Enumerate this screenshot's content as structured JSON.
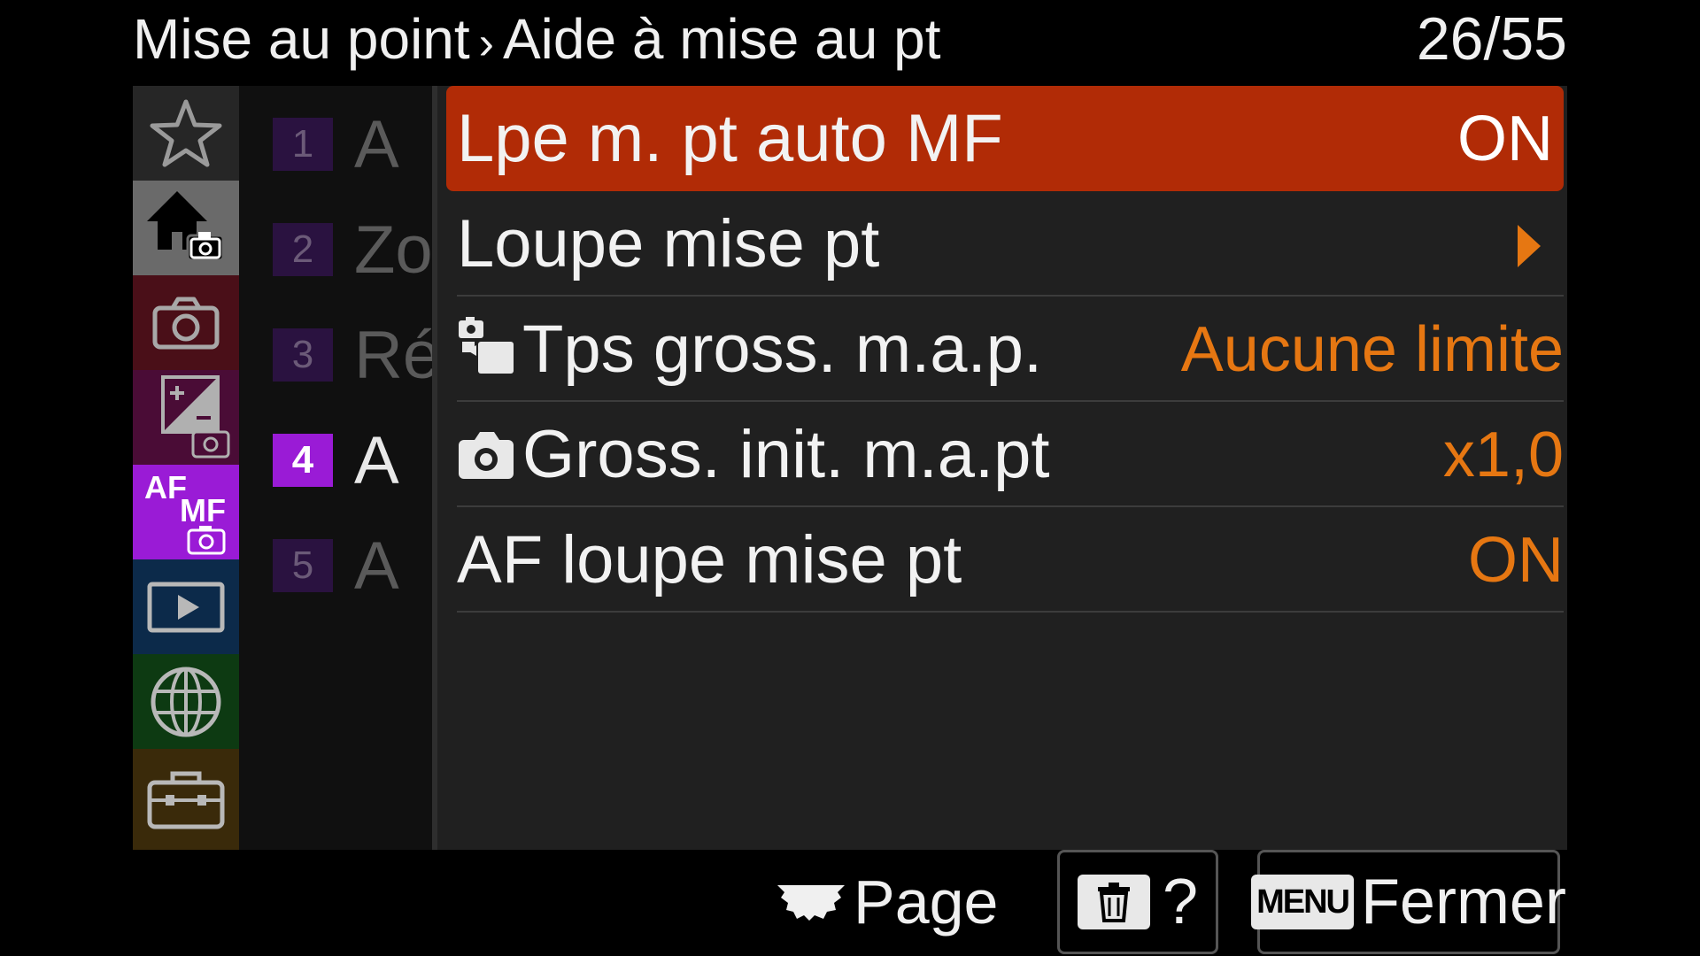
{
  "header": {
    "section": "Mise au point",
    "separator": "›",
    "subsection": "Aide à mise au pt",
    "page_indicator": "26/55"
  },
  "rail": {
    "categories": [
      {
        "name": "favorites",
        "icon": "star-icon",
        "color": "#262626",
        "active": false
      },
      {
        "name": "main-shooting",
        "icon": "home-camera-icon",
        "color": "#6a6a6a",
        "active": true
      },
      {
        "name": "shooting",
        "icon": "camera-icon",
        "color": "#4a0f18",
        "active": false
      },
      {
        "name": "exposure-color",
        "icon": "exposure-comp-icon",
        "color": "#4a0c36",
        "active": false
      },
      {
        "name": "focus",
        "icon": "af-mf-icon",
        "label_top": "AF",
        "label_bottom": "MF",
        "color": "#9a1bd6",
        "active": true
      },
      {
        "name": "playback",
        "icon": "playback-icon",
        "color": "#0c2a4a",
        "active": false
      },
      {
        "name": "network",
        "icon": "globe-icon",
        "color": "#0d3a12",
        "active": false
      },
      {
        "name": "setup",
        "icon": "toolbox-icon",
        "color": "#3a2a0a",
        "active": false
      }
    ]
  },
  "pages": {
    "items": [
      {
        "num": "1",
        "letter": "A",
        "active": false
      },
      {
        "num": "2",
        "letter": "Zo",
        "active": false
      },
      {
        "num": "3",
        "letter": "Ré",
        "active": false
      },
      {
        "num": "4",
        "letter": "A",
        "active": true
      },
      {
        "num": "5",
        "letter": "A",
        "active": false
      }
    ]
  },
  "menu": {
    "items": [
      {
        "label": "Lpe m. pt auto MF",
        "value": "ON",
        "selected": true
      },
      {
        "label": "Loupe mise pt",
        "value": "",
        "arrow": true
      },
      {
        "label": "Tps gross. m.a.p.",
        "value": "Aucune limite",
        "icon": "photo-movie-icon"
      },
      {
        "label": "Gross. init. m.a.pt",
        "value": "x1,0",
        "icon": "camera-icon"
      },
      {
        "label": "AF loupe mise pt",
        "value": "ON"
      }
    ],
    "accent_color": "#e67712",
    "selected_color": "#b12b06"
  },
  "footer": {
    "page_label": "Page",
    "help_label": "?",
    "menu_key": "MENU",
    "close_label": "Fermer"
  }
}
